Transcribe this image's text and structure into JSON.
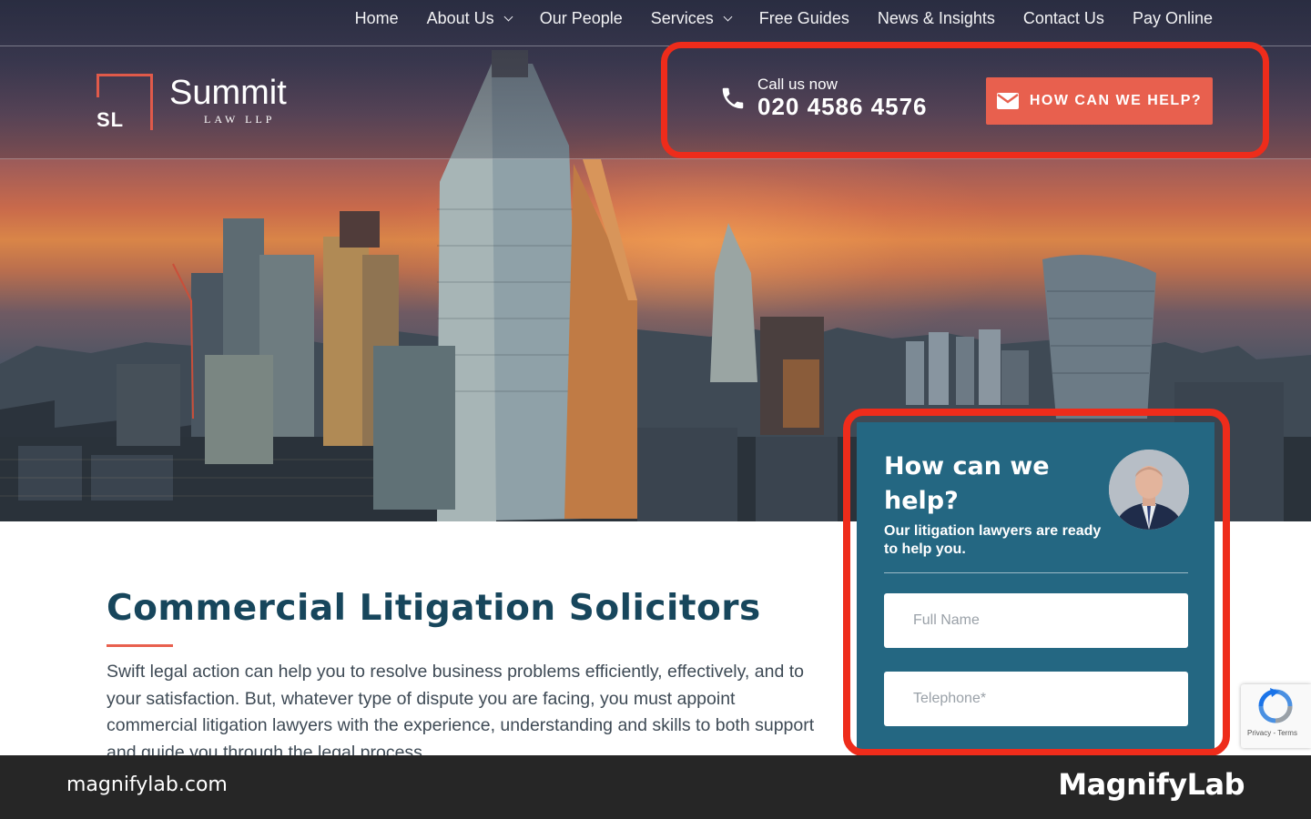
{
  "nav": {
    "items": [
      {
        "label": "Home",
        "has_dropdown": false
      },
      {
        "label": "About Us",
        "has_dropdown": true
      },
      {
        "label": "Our People",
        "has_dropdown": false
      },
      {
        "label": "Services",
        "has_dropdown": true
      },
      {
        "label": "Free Guides",
        "has_dropdown": false
      },
      {
        "label": "News & Insights",
        "has_dropdown": false
      },
      {
        "label": "Contact Us",
        "has_dropdown": false
      },
      {
        "label": "Pay Online",
        "has_dropdown": false
      }
    ]
  },
  "logo": {
    "monogram": "SL",
    "name": "Summit",
    "subtitle": "LAW LLP"
  },
  "header": {
    "call_label": "Call us now",
    "phone": "020 4586 4576",
    "cta_label": "HOW CAN WE HELP?",
    "cta_icon": "envelope-icon",
    "phone_icon": "phone-icon"
  },
  "main": {
    "title": "Commercial Litigation Solicitors",
    "intro": "Swift legal action can help you to resolve business problems efficiently, effectively, and to your satisfaction. But, whatever type of dispute you are facing, you must appoint commercial litigation lawyers with the experience, understanding and skills to both support and guide you through the legal process."
  },
  "form": {
    "title": "How can we help?",
    "subtitle": "Our litigation lawyers are ready to help you.",
    "name_placeholder": "Full Name",
    "phone_placeholder": "Telephone*"
  },
  "recaptcha": {
    "text": "Privacy - Terms"
  },
  "footer": {
    "url": "magnifylab.com",
    "brand": "MagnifyLab"
  },
  "colors": {
    "accent": "#e8604e",
    "title": "#17465c",
    "form_panel": "#246782",
    "highlight": "#ee2c1b",
    "footer": "#262626"
  }
}
